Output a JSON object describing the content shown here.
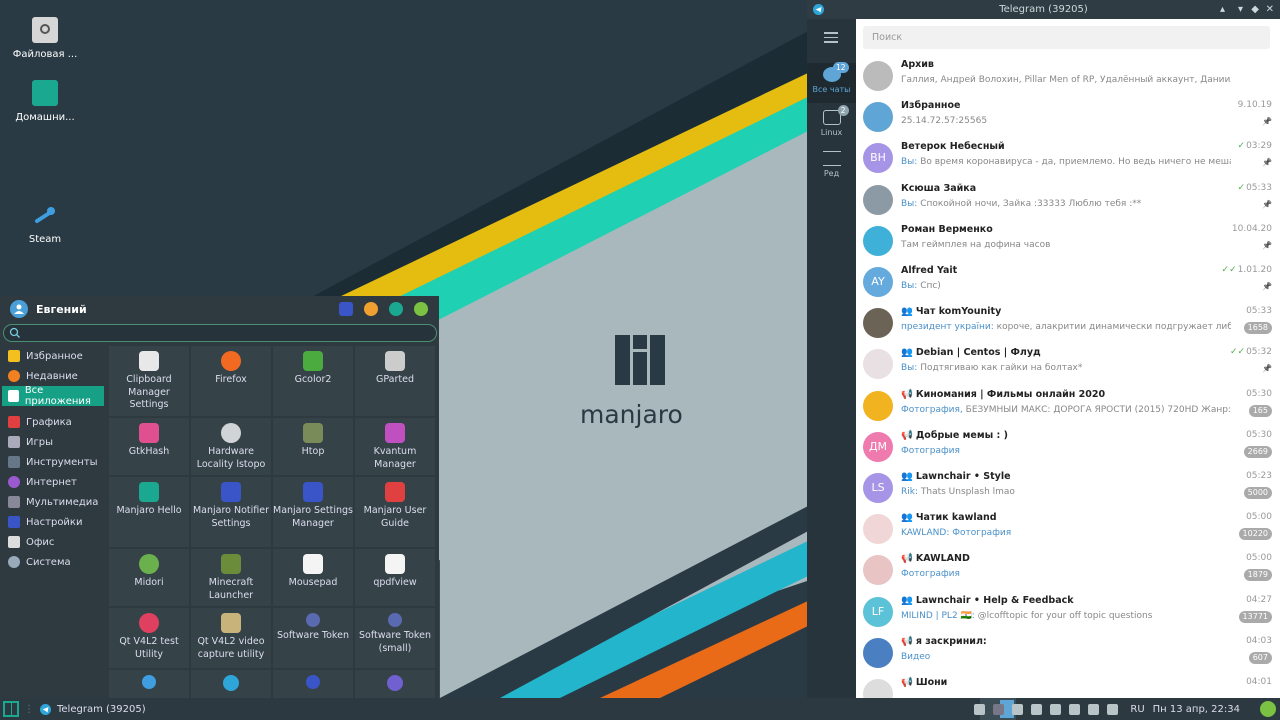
{
  "desktop": {
    "icons": [
      {
        "label": "Файловая ...",
        "icon": "disk-icon"
      },
      {
        "label": "Домашни...",
        "icon": "home-folder-icon"
      },
      {
        "label": "Steam",
        "icon": "steam-icon"
      }
    ],
    "logo_text": "manjaro"
  },
  "menu": {
    "user": "Евгений",
    "search_placeholder": "",
    "categories": [
      "Избранное",
      "Недавние",
      "Все приложения",
      "Графика",
      "Игры",
      "Инструменты",
      "Интернет",
      "Мультимедиа",
      "Настройки",
      "Офис",
      "Система"
    ],
    "apps": [
      [
        "Clipboard Manager Settings",
        "Firefox",
        "Gcolor2",
        "GParted"
      ],
      [
        "GtkHash",
        "Hardware Locality lstopo",
        "Htop",
        "Kvantum Manager"
      ],
      [
        "Manjaro Hello",
        "Manjaro Notifier Settings",
        "Manjaro Settings Manager",
        "Manjaro User Guide"
      ],
      [
        "Midori",
        "Minecraft Launcher",
        "Mousepad",
        "qpdfview"
      ],
      [
        "Qt V4L2 test Utility",
        "Qt V4L2 video capture utility",
        "Software Token",
        "Software Token (small)"
      ]
    ]
  },
  "taskbar": {
    "window_label": "Telegram (39205)",
    "lang": "RU",
    "clock": "Пн 13 апр, 22:34"
  },
  "telegram": {
    "title": "Telegram (39205)",
    "search_placeholder": "Поиск",
    "sidebar": {
      "all_chats": "Все чаты",
      "all_chats_badge": "12",
      "folder_linux": "Linux",
      "folder_linux_badge": "2",
      "edit": "Ред"
    },
    "chats": [
      {
        "name": "Архив",
        "time": "",
        "sender": "",
        "preview": "Галлия, Андрей Волохин, Pillar Men of RP, Удалённый аккаунт, Даниил Деревяновский, ...",
        "badge": "",
        "pinned": false,
        "avatar": "",
        "avatar_color": "#bbbbbb"
      },
      {
        "name": "Избранное",
        "time": "9.10.19",
        "sender": "",
        "preview": "25.14.72.57:25565",
        "badge": "",
        "pinned": true,
        "avatar": "",
        "avatar_color": "#5fa6d6"
      },
      {
        "name": "Ветерок Небесный",
        "time": "03:29",
        "check": "✓",
        "sender": "Вы:",
        "preview": "Во время коронавируса - да, приемлемо. Но ведь ничего не мешает издать з...",
        "badge": "",
        "pinned": true,
        "avatar": "ВН",
        "avatar_color": "#a695e7"
      },
      {
        "name": "Ксюша Зайка",
        "time": "05:33",
        "check": "✓",
        "sender": "Вы:",
        "preview": "Спокойной ночи, Зайка :33333 Люблю тебя :**",
        "badge": "",
        "pinned": true,
        "avatar": "",
        "avatar_color": "#8c9aa5"
      },
      {
        "name": "Роман Верменко",
        "time": "10.04.20",
        "sender": "",
        "preview": "Там геймплея на дофина часов",
        "badge": "",
        "pinned": true,
        "avatar": "",
        "avatar_color": "#3fb0d8"
      },
      {
        "name": "Alfred Yait",
        "time": "1.01.20",
        "check": "✓✓",
        "sender": "Вы:",
        "preview": "Спс)",
        "badge": "",
        "pinned": true,
        "avatar": "AY",
        "avatar_color": "#65aadd"
      },
      {
        "name": "Чат komYounity",
        "type": "group",
        "time": "05:33",
        "sender": "президент україни:",
        "preview": "короче, алакритии динамически подгружает либы иксов/в...",
        "badge": "1658",
        "pinned": false,
        "avatar": "",
        "avatar_color": "#6b6356"
      },
      {
        "name": "Debian | Centos | Флуд",
        "type": "group",
        "time": "05:32",
        "check": "✓✓",
        "sender": "Вы:",
        "preview": "Подтягиваю как гайки на болтах*",
        "badge": "",
        "pinned": true,
        "avatar": "",
        "avatar_color": "#e8e0e2"
      },
      {
        "name": "Киномания | Фильмы онлайн 2020",
        "type": "channel",
        "time": "05:30",
        "sender": "Фотография,",
        "preview": "БЕЗУМНЫЙ МАКС: ДОРОГА ЯРОСТИ (2015) 720HD  Жанр: #боевик #...",
        "badge": "165",
        "pinned": false,
        "avatar": "",
        "avatar_color": "#f2b320"
      },
      {
        "name": "Добрые мемы : )",
        "type": "channel",
        "time": "05:30",
        "sender": "Фотография",
        "preview": "",
        "badge": "2669",
        "pinned": false,
        "avatar": "ДМ",
        "avatar_color": "#ee7aae"
      },
      {
        "name": "Lawnchair • Style",
        "type": "group",
        "time": "05:23",
        "sender": "Rik:",
        "preview": "Thats Unsplash lmao",
        "badge": "5000",
        "pinned": false,
        "avatar": "LS",
        "avatar_color": "#a695e7"
      },
      {
        "name": "Чатик kawland",
        "type": "group",
        "time": "05:00",
        "sender": "KAWLAND: Фотография",
        "preview": "",
        "badge": "10220",
        "pinned": false,
        "avatar": "",
        "avatar_color": "#f0d6d6"
      },
      {
        "name": "KAWLAND",
        "type": "channel",
        "time": "05:00",
        "sender": "Фотография",
        "preview": "",
        "badge": "1879",
        "pinned": false,
        "avatar": "",
        "avatar_color": "#e9c4c4"
      },
      {
        "name": "Lawnchair • Help & Feedback",
        "type": "group",
        "time": "04:27",
        "sender": "MILIND | PL2 🇮🇳:",
        "preview": "@lcofftopic for your off topic questions",
        "badge": "13771",
        "pinned": false,
        "avatar": "LF",
        "avatar_color": "#5cc2d8"
      },
      {
        "name": "я заскринил:",
        "type": "channel",
        "time": "04:03",
        "sender": "Видео",
        "preview": "",
        "badge": "607",
        "pinned": false,
        "avatar": "",
        "avatar_color": "#4a7fc1"
      },
      {
        "name": "Шони",
        "type": "channel",
        "time": "04:01",
        "sender": "",
        "preview": "",
        "badge": "",
        "pinned": false,
        "avatar": "",
        "avatar_color": "#dddddd"
      }
    ]
  },
  "colors": {
    "accent": "#16a085",
    "telegram_blue": "#5fa6d6"
  }
}
